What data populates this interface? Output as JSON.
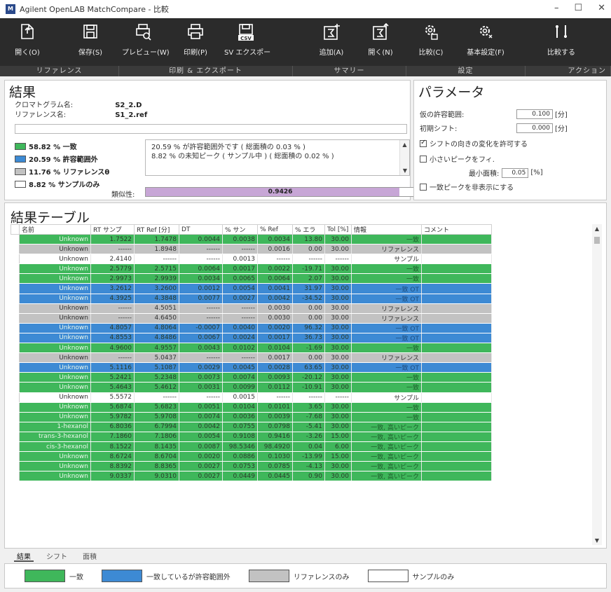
{
  "window": {
    "title": "Agilent OpenLAB MatchCompare - 比較",
    "icon_text": "M"
  },
  "ribbon": {
    "buttons": [
      {
        "label": "開く(O)",
        "icon": "open-file-icon"
      },
      {
        "label": "保存(S)",
        "icon": "save-icon"
      },
      {
        "label": "プレビュー(W)",
        "icon": "print-preview-icon"
      },
      {
        "label": "印刷(P)",
        "icon": "print-icon"
      },
      {
        "label": "SV エクスポー",
        "icon": "csv-export-icon",
        "icon_text": "CSV"
      },
      {
        "label": "追加(A)",
        "icon": "summary-add-icon"
      },
      {
        "label": "開く(N)",
        "icon": "summary-open-icon"
      },
      {
        "label": "比較(C)",
        "icon": "compare-settings-icon"
      },
      {
        "label": "基本設定(F)",
        "icon": "preferences-icon"
      },
      {
        "label": "比較する",
        "icon": "run-compare-icon"
      }
    ],
    "groups": [
      "リファレンス",
      "印刷 & エクスポート",
      "サマリー",
      "設定",
      "アクション"
    ]
  },
  "result": {
    "title": "結果",
    "chromatogram_label": "クロマトグラム名:",
    "chromatogram_value": "S2_2.D",
    "reference_label": "リファレンス名:",
    "reference_value": "S1_2.ref",
    "legend": [
      {
        "text": "58.82 % 一致",
        "color": "#3fb75b"
      },
      {
        "text": "20.59 % 許容範囲外",
        "color": "#3d8ad4"
      },
      {
        "text": "11.76 % リファレンスθ",
        "color": "#c2c2c2"
      },
      {
        "text": "8.82 % サンプルのみ",
        "color": "#ffffff"
      }
    ],
    "messages": [
      "20.59 % が許容範囲外です ( 総面積の 0.03 % )",
      "8.82 % の未知ピーク ( サンプル中 ) ( 総面積の 0.02 % )"
    ],
    "similarity_label": "類似性:",
    "similarity_value": "0.9426",
    "similarity_fraction": 0.9426
  },
  "params": {
    "title": "パラメータ",
    "tolerance_label": "仮の許容範囲:",
    "tolerance_value": "0.100",
    "tolerance_unit": "[分]",
    "shift_label": "初期シフト:",
    "shift_value": "0.000",
    "shift_unit": "[分]",
    "allow_shift_label": "シフトの向きの変化を許可する",
    "allow_shift_checked": true,
    "small_peak_label": "小さいピークをフィ.",
    "small_peak_checked": false,
    "min_area_label": "最小面積:",
    "min_area_value": "0.05",
    "min_area_unit": "[%]",
    "hide_match_label": "一致ピークを非表示にする",
    "hide_match_checked": false
  },
  "table": {
    "title": "結果テーブル",
    "columns": [
      "名前",
      "RT サンプ",
      "RT Ref [分]",
      "DT",
      "% サン",
      "% Ref",
      "% エラ",
      "Tol [%]",
      "情報",
      "コメント"
    ],
    "rows": [
      {
        "s": "match",
        "c": [
          "Unknown",
          "1.7522",
          "1.7478",
          "0.0044",
          "0.0038",
          "0.0034",
          "13.80",
          "30.00",
          "一致",
          ""
        ]
      },
      {
        "s": "ref",
        "c": [
          "Unknown",
          "------",
          "1.8948",
          "------",
          "------",
          "0.0016",
          "0.00",
          "30.00",
          "リファレンス",
          ""
        ]
      },
      {
        "s": "sample",
        "c": [
          "Unknown",
          "2.4140",
          "------",
          "------",
          "0.0013",
          "------",
          "------",
          "------",
          "サンプル",
          ""
        ]
      },
      {
        "s": "match",
        "c": [
          "Unknown",
          "2.5779",
          "2.5715",
          "0.0064",
          "0.0017",
          "0.0022",
          "-19.71",
          "30.00",
          "一致",
          ""
        ]
      },
      {
        "s": "match",
        "c": [
          "Unknown",
          "2.9973",
          "2.9939",
          "0.0034",
          "0.0065",
          "0.0064",
          "2.07",
          "30.00",
          "一致",
          ""
        ]
      },
      {
        "s": "out",
        "c": [
          "Unknown",
          "3.2612",
          "3.2600",
          "0.0012",
          "0.0054",
          "0.0041",
          "31.97",
          "30.00",
          "一致 OT",
          ""
        ]
      },
      {
        "s": "out",
        "c": [
          "Unknown",
          "4.3925",
          "4.3848",
          "0.0077",
          "0.0027",
          "0.0042",
          "-34.52",
          "30.00",
          "一致 OT",
          ""
        ]
      },
      {
        "s": "ref",
        "c": [
          "Unknown",
          "------",
          "4.5051",
          "------",
          "------",
          "0.0030",
          "0.00",
          "30.00",
          "リファレンス",
          ""
        ]
      },
      {
        "s": "ref",
        "c": [
          "Unknown",
          "------",
          "4.6450",
          "------",
          "------",
          "0.0030",
          "0.00",
          "30.00",
          "リファレンス",
          ""
        ]
      },
      {
        "s": "out",
        "c": [
          "Unknown",
          "4.8057",
          "4.8064",
          "-0.0007",
          "0.0040",
          "0.0020",
          "96.32",
          "30.00",
          "一致 OT",
          ""
        ]
      },
      {
        "s": "out",
        "c": [
          "Unknown",
          "4.8553",
          "4.8486",
          "0.0067",
          "0.0024",
          "0.0017",
          "36.73",
          "30.00",
          "一致 OT",
          ""
        ]
      },
      {
        "s": "match",
        "c": [
          "Unknown",
          "4.9600",
          "4.9557",
          "0.0043",
          "0.0102",
          "0.0104",
          "-1.69",
          "30.00",
          "一致",
          ""
        ]
      },
      {
        "s": "ref",
        "c": [
          "Unknown",
          "------",
          "5.0437",
          "------",
          "------",
          "0.0017",
          "0.00",
          "30.00",
          "リファレンス",
          ""
        ]
      },
      {
        "s": "out",
        "c": [
          "Unknown",
          "5.1116",
          "5.1087",
          "0.0029",
          "0.0045",
          "0.0028",
          "63.65",
          "30.00",
          "一致 OT",
          ""
        ]
      },
      {
        "s": "match",
        "c": [
          "Unknown",
          "5.2421",
          "5.2348",
          "0.0073",
          "0.0074",
          "0.0093",
          "-20.12",
          "30.00",
          "一致",
          ""
        ]
      },
      {
        "s": "match",
        "c": [
          "Unknown",
          "5.4643",
          "5.4612",
          "0.0031",
          "0.0099",
          "0.0112",
          "-10.91",
          "30.00",
          "一致",
          ""
        ]
      },
      {
        "s": "sample",
        "c": [
          "Unknown",
          "5.5572",
          "------",
          "------",
          "0.0015",
          "------",
          "------",
          "------",
          "サンプル",
          ""
        ]
      },
      {
        "s": "match",
        "c": [
          "Unknown",
          "5.6874",
          "5.6823",
          "0.0051",
          "0.0104",
          "0.0101",
          "3.65",
          "30.00",
          "一致",
          ""
        ]
      },
      {
        "s": "match",
        "c": [
          "Unknown",
          "5.9782",
          "5.9708",
          "0.0074",
          "0.0036",
          "0.0039",
          "-7.68",
          "30.00",
          "一致",
          ""
        ]
      },
      {
        "s": "match",
        "c": [
          "1-hexanol",
          "6.8036",
          "6.7994",
          "0.0042",
          "0.0755",
          "0.0798",
          "-5.41",
          "30.00",
          "一致, 高いピーク",
          ""
        ]
      },
      {
        "s": "match",
        "c": [
          "trans-3-hexanol",
          "7.1860",
          "7.1806",
          "0.0054",
          "0.9108",
          "0.9416",
          "-3.26",
          "15.00",
          "一致, 高いピーク",
          ""
        ]
      },
      {
        "s": "match",
        "c": [
          "cis-3-hexanol",
          "8.1522",
          "8.1435",
          "0.0087",
          "98.5346",
          "98.4920",
          "0.04",
          "6.00",
          "一致, 高いピーク",
          ""
        ]
      },
      {
        "s": "match",
        "c": [
          "Unknown",
          "8.6724",
          "8.6704",
          "0.0020",
          "0.0886",
          "0.1030",
          "-13.99",
          "15.00",
          "一致, 高いピーク",
          ""
        ]
      },
      {
        "s": "match",
        "c": [
          "Unknown",
          "8.8392",
          "8.8365",
          "0.0027",
          "0.0753",
          "0.0785",
          "-4.13",
          "30.00",
          "一致, 高いピーク",
          ""
        ]
      },
      {
        "s": "match",
        "c": [
          "Unknown",
          "9.0337",
          "9.0310",
          "0.0027",
          "0.0449",
          "0.0445",
          "0.90",
          "30.00",
          "一致, 高いピーク",
          ""
        ]
      }
    ]
  },
  "tabs": [
    "結果",
    "シフト",
    "面積"
  ],
  "footer_legend": [
    {
      "label": "一致",
      "color": "#3fb75b"
    },
    {
      "label": "一致しているが許容範囲外",
      "color": "#3d8ad4"
    },
    {
      "label": "リファレンスのみ",
      "color": "#c2c2c2"
    },
    {
      "label": "サンプルのみ",
      "color": "#ffffff"
    }
  ]
}
